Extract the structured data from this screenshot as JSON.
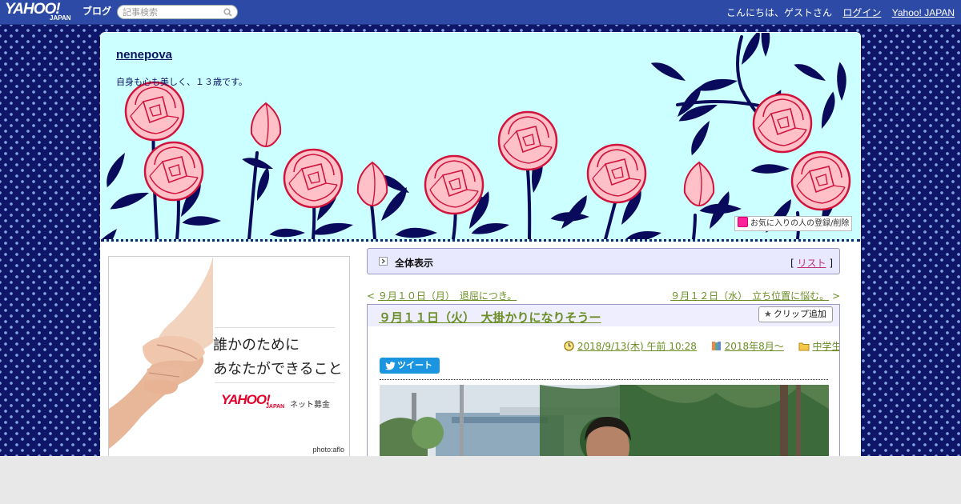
{
  "topbar": {
    "logo_text": "YAHOO!",
    "logo_sub": "JAPAN",
    "logo_blog": "ブログ",
    "search_placeholder": "記事検索",
    "greeting": "こんにちは、ゲストさん",
    "login": "ログイン",
    "yahoo_japan": "Yahoo! JAPAN"
  },
  "header": {
    "blog_title": "nenepova",
    "blog_description": "自身も心も美しく、１３歳です。",
    "favorite_button": "お気に入りの人の登録/削除"
  },
  "ad": {
    "line1": "誰かのために",
    "line2": "あなたができること",
    "logo_text": "YAHOO!",
    "logo_sub": "JAPAN",
    "service": "ネット募金",
    "credit": "photo:aflo"
  },
  "view_all": {
    "label": "全体表示",
    "bracket_open": "[",
    "list_link": "リスト",
    "bracket_close": "]"
  },
  "nav": {
    "prev_arrow": "<",
    "prev_title": "９月１０日（月）　退屈につき。",
    "next_title": "９月１２日（水）　立ち位置に悩む。",
    "next_arrow": ">"
  },
  "article": {
    "title": "９月１１日（火）　大掛かりになりそうー",
    "clip_button": "クリップ追加",
    "date": "2018/9/13(木) 午前 10:28",
    "book_link": "2018年8月～",
    "category": "中学生",
    "tweet": "ツイート"
  },
  "colors": {
    "topbar": "#2d4ba6",
    "background_navy": "#0f166a",
    "header_bg": "#ccffff",
    "rose_pink": "#ffc0c8",
    "rose_edge": "#d0143c",
    "link_green": "#6a8e23"
  }
}
